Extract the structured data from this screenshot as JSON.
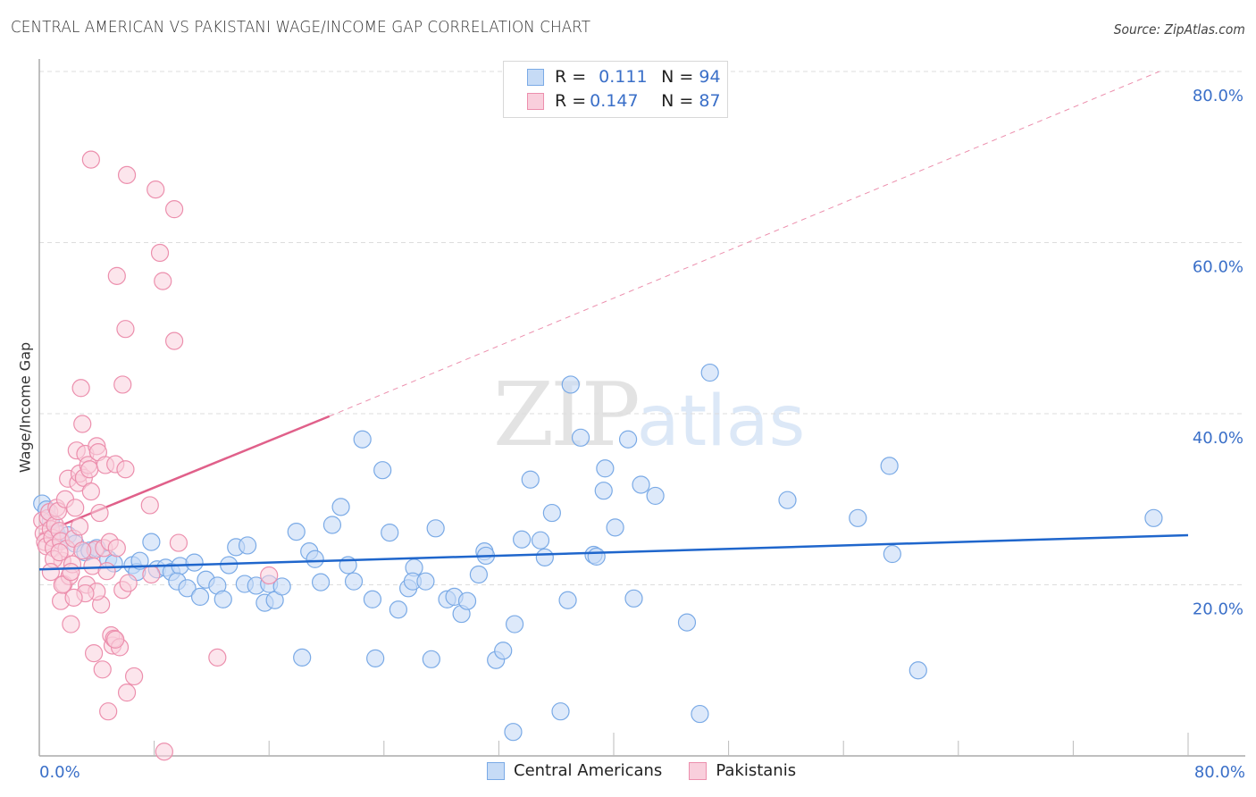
{
  "header": {
    "title": "CENTRAL AMERICAN VS PAKISTANI WAGE/INCOME GAP CORRELATION CHART",
    "source": "Source: ZipAtlas.com"
  },
  "watermark": {
    "zip": "ZIP",
    "atlas": "atlas"
  },
  "legend_top": {
    "rows": [
      {
        "r_label": "R = ",
        "r_value": "0.111",
        "n_label": "N = ",
        "n_value": "94"
      },
      {
        "r_label": "R = ",
        "r_value": "0.147",
        "n_label": "N = ",
        "n_value": "87"
      }
    ]
  },
  "legend_bottom": {
    "items": [
      {
        "label": "Central Americans"
      },
      {
        "label": "Pakistanis"
      }
    ]
  },
  "chart_data": {
    "type": "scatter",
    "title": "CENTRAL AMERICAN VS PAKISTANI WAGE/INCOME GAP CORRELATION CHART",
    "xlabel": "",
    "ylabel": "Wage/Income Gap",
    "xlim": [
      0,
      80
    ],
    "ylim": [
      0,
      80
    ],
    "x_tick_labels": [
      "0.0%",
      "80.0%"
    ],
    "y_ticks": [
      20,
      40,
      60,
      80
    ],
    "y_tick_labels": [
      "20.0%",
      "40.0%",
      "60.0%",
      "80.0%"
    ],
    "grid": true,
    "legend_placement": "top-center",
    "colors": {
      "central_americans": "#7aaae6",
      "central_americans_fill": "#c6dbf6",
      "central_americans_line": "#1f66cc",
      "pakistanis": "#ec8fad",
      "pakistanis_fill": "#f9cfdc",
      "pakistanis_line": "#e0608a"
    },
    "series": [
      {
        "name": "Central Americans",
        "r": 0.111,
        "n": 94,
        "trend": {
          "x0": 0,
          "y0": 21.8,
          "x1": 80,
          "y1": 25.8,
          "dashed_extension": false
        },
        "points": [
          [
            0.2,
            29.5
          ],
          [
            0.5,
            28.8
          ],
          [
            0.8,
            27.5
          ],
          [
            1.2,
            26.0
          ],
          [
            1.5,
            25.3
          ],
          [
            2.0,
            25.8
          ],
          [
            2.5,
            24.8
          ],
          [
            3.2,
            23.8
          ],
          [
            3.5,
            24.0
          ],
          [
            4.0,
            24.3
          ],
          [
            4.8,
            23.0
          ],
          [
            5.2,
            22.5
          ],
          [
            6.5,
            22.3
          ],
          [
            6.8,
            21.5
          ],
          [
            7.0,
            22.8
          ],
          [
            7.8,
            25.0
          ],
          [
            8.2,
            21.8
          ],
          [
            8.8,
            22.0
          ],
          [
            9.2,
            21.5
          ],
          [
            9.8,
            22.2
          ],
          [
            9.6,
            20.4
          ],
          [
            10.3,
            19.6
          ],
          [
            10.8,
            22.6
          ],
          [
            11.2,
            18.6
          ],
          [
            11.6,
            20.6
          ],
          [
            12.4,
            19.9
          ],
          [
            12.8,
            18.3
          ],
          [
            13.2,
            22.3
          ],
          [
            13.7,
            24.4
          ],
          [
            14.5,
            24.6
          ],
          [
            14.3,
            20.1
          ],
          [
            15.1,
            19.9
          ],
          [
            15.7,
            17.9
          ],
          [
            16.0,
            20.1
          ],
          [
            16.4,
            18.2
          ],
          [
            16.9,
            19.8
          ],
          [
            17.9,
            26.2
          ],
          [
            18.3,
            11.5
          ],
          [
            18.8,
            23.9
          ],
          [
            19.2,
            23.0
          ],
          [
            19.6,
            20.3
          ],
          [
            20.4,
            27.0
          ],
          [
            21.0,
            29.1
          ],
          [
            21.5,
            22.3
          ],
          [
            21.9,
            20.4
          ],
          [
            22.5,
            37.0
          ],
          [
            23.2,
            18.3
          ],
          [
            23.4,
            11.4
          ],
          [
            23.9,
            33.4
          ],
          [
            24.4,
            26.1
          ],
          [
            25.0,
            17.1
          ],
          [
            25.7,
            19.6
          ],
          [
            26.1,
            22.0
          ],
          [
            26.0,
            20.4
          ],
          [
            26.9,
            20.4
          ],
          [
            27.3,
            11.3
          ],
          [
            27.6,
            26.6
          ],
          [
            28.4,
            18.3
          ],
          [
            28.9,
            18.6
          ],
          [
            29.4,
            16.6
          ],
          [
            29.8,
            18.1
          ],
          [
            30.6,
            21.2
          ],
          [
            31.0,
            23.9
          ],
          [
            31.1,
            23.4
          ],
          [
            31.8,
            11.2
          ],
          [
            32.3,
            12.3
          ],
          [
            33.0,
            2.8
          ],
          [
            33.1,
            15.4
          ],
          [
            33.6,
            25.3
          ],
          [
            34.2,
            32.3
          ],
          [
            34.9,
            25.2
          ],
          [
            35.2,
            23.2
          ],
          [
            35.7,
            28.4
          ],
          [
            36.3,
            5.2
          ],
          [
            36.8,
            18.2
          ],
          [
            37.0,
            43.4
          ],
          [
            37.7,
            37.2
          ],
          [
            38.6,
            23.5
          ],
          [
            38.8,
            23.3
          ],
          [
            39.3,
            31.0
          ],
          [
            39.4,
            33.6
          ],
          [
            40.1,
            26.7
          ],
          [
            41.0,
            37.0
          ],
          [
            41.4,
            18.4
          ],
          [
            41.9,
            31.7
          ],
          [
            42.9,
            30.4
          ],
          [
            45.1,
            15.6
          ],
          [
            46.0,
            4.9
          ],
          [
            46.7,
            44.8
          ],
          [
            52.1,
            29.9
          ],
          [
            57.0,
            27.8
          ],
          [
            59.2,
            33.9
          ],
          [
            59.4,
            23.6
          ],
          [
            61.2,
            10.0
          ],
          [
            77.6,
            27.8
          ]
        ]
      },
      {
        "name": "Pakistanis",
        "r": 0.147,
        "n": 87,
        "trend": {
          "x0": 0,
          "y0": 25.9,
          "x1": 20.2,
          "y1": 39.7,
          "dashed_extension": true,
          "dashed_x1": 78.0,
          "dashed_y1": 80.0
        },
        "points": [
          [
            0.2,
            27.5
          ],
          [
            0.3,
            26.0
          ],
          [
            0.4,
            25.0
          ],
          [
            0.5,
            24.5
          ],
          [
            0.6,
            27.8
          ],
          [
            0.7,
            28.5
          ],
          [
            0.8,
            26.5
          ],
          [
            0.9,
            25.5
          ],
          [
            1.0,
            24.3
          ],
          [
            1.1,
            27.0
          ],
          [
            1.2,
            29.0
          ],
          [
            1.3,
            28.6
          ],
          [
            1.4,
            26.3
          ],
          [
            1.5,
            25.1
          ],
          [
            1.6,
            22.8
          ],
          [
            1.7,
            20.1
          ],
          [
            1.5,
            18.1
          ],
          [
            1.8,
            30.0
          ],
          [
            1.9,
            24.2
          ],
          [
            2.0,
            32.4
          ],
          [
            2.1,
            21.0
          ],
          [
            2.2,
            15.4
          ],
          [
            2.3,
            22.4
          ],
          [
            2.4,
            25.4
          ],
          [
            2.5,
            29.0
          ],
          [
            2.6,
            35.7
          ],
          [
            2.7,
            31.9
          ],
          [
            2.8,
            33.0
          ],
          [
            2.9,
            43.0
          ],
          [
            3.0,
            38.8
          ],
          [
            3.1,
            32.5
          ],
          [
            3.2,
            35.3
          ],
          [
            3.3,
            20.0
          ],
          [
            3.4,
            34.0
          ],
          [
            3.5,
            33.5
          ],
          [
            3.6,
            30.9
          ],
          [
            3.7,
            22.2
          ],
          [
            3.8,
            12.0
          ],
          [
            3.9,
            24.1
          ],
          [
            4.0,
            36.2
          ],
          [
            4.1,
            35.5
          ],
          [
            4.2,
            28.4
          ],
          [
            4.3,
            17.7
          ],
          [
            4.4,
            10.1
          ],
          [
            4.5,
            24.3
          ],
          [
            4.6,
            34.0
          ],
          [
            4.7,
            21.6
          ],
          [
            4.8,
            5.2
          ],
          [
            4.9,
            25.0
          ],
          [
            5.0,
            14.1
          ],
          [
            5.1,
            12.9
          ],
          [
            5.2,
            13.7
          ],
          [
            5.3,
            34.1
          ],
          [
            5.4,
            24.3
          ],
          [
            5.6,
            12.7
          ],
          [
            5.8,
            43.4
          ],
          [
            5.8,
            19.4
          ],
          [
            6.0,
            33.5
          ],
          [
            5.3,
            13.6
          ],
          [
            6.1,
            7.4
          ],
          [
            6.2,
            20.2
          ],
          [
            6.6,
            9.3
          ],
          [
            6.1,
            67.9
          ],
          [
            3.6,
            69.7
          ],
          [
            5.4,
            56.1
          ],
          [
            6.0,
            49.9
          ],
          [
            7.7,
            29.3
          ],
          [
            7.8,
            21.2
          ],
          [
            8.1,
            66.2
          ],
          [
            8.4,
            58.8
          ],
          [
            8.6,
            55.5
          ],
          [
            9.4,
            63.9
          ],
          [
            9.4,
            48.5
          ],
          [
            9.7,
            24.9
          ],
          [
            12.4,
            11.5
          ],
          [
            16.0,
            21.1
          ],
          [
            8.7,
            0.5
          ],
          [
            4.0,
            19.2
          ],
          [
            3.2,
            19.0
          ],
          [
            2.4,
            18.5
          ],
          [
            1.6,
            20.0
          ],
          [
            2.2,
            21.5
          ],
          [
            1.0,
            23.0
          ],
          [
            0.8,
            21.5
          ],
          [
            3.0,
            24.0
          ],
          [
            2.8,
            26.8
          ],
          [
            1.4,
            23.8
          ]
        ]
      }
    ]
  }
}
